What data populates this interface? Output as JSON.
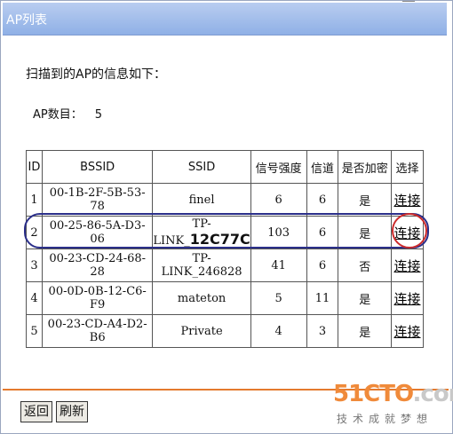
{
  "window": {
    "title": "AP列表"
  },
  "info": {
    "scan_line": "扫描到的AP的信息如下：",
    "count_label": "AP数目：",
    "count_value": "5"
  },
  "table": {
    "headers": [
      "ID",
      "BSSID",
      "SSID",
      "信号强度",
      "信道",
      "是否加密",
      "选择"
    ],
    "rows": [
      {
        "id": "1",
        "bssid": "00-1B-2F-5B-53-78",
        "ssid": "finel",
        "signal": "6",
        "channel": "6",
        "encrypted": "是",
        "select": "连接"
      },
      {
        "id": "2",
        "bssid": "00-25-86-5A-D3-06",
        "ssid": "TP-LINK_",
        "ssid_overlay": "12C77C",
        "signal": "103",
        "channel": "6",
        "encrypted": "是",
        "select": "连接"
      },
      {
        "id": "3",
        "bssid": "00-23-CD-24-68-28",
        "ssid": "TP-LINK_246828",
        "signal": "41",
        "channel": "6",
        "encrypted": "否",
        "select": "连接"
      },
      {
        "id": "4",
        "bssid": "00-0D-0B-12-C6-F9",
        "ssid": "mateton",
        "signal": "5",
        "channel": "11",
        "encrypted": "是",
        "select": "连接"
      },
      {
        "id": "5",
        "bssid": "00-23-CD-A4-D2-B6",
        "ssid": "Private",
        "signal": "4",
        "channel": "3",
        "encrypted": "是",
        "select": "连接"
      }
    ]
  },
  "buttons": {
    "back": "返回",
    "refresh": "刷新"
  },
  "watermark": {
    "brand_a": "51CTO",
    "brand_b": ".com",
    "tagline": "技术成就梦想"
  },
  "colors": {
    "title_bar": "#8fb0e6",
    "row_highlight": "#2b2f8a",
    "select_circle": "#cc2b2b",
    "footer_line": "#e47a2e",
    "brand": "#f08a3a"
  }
}
